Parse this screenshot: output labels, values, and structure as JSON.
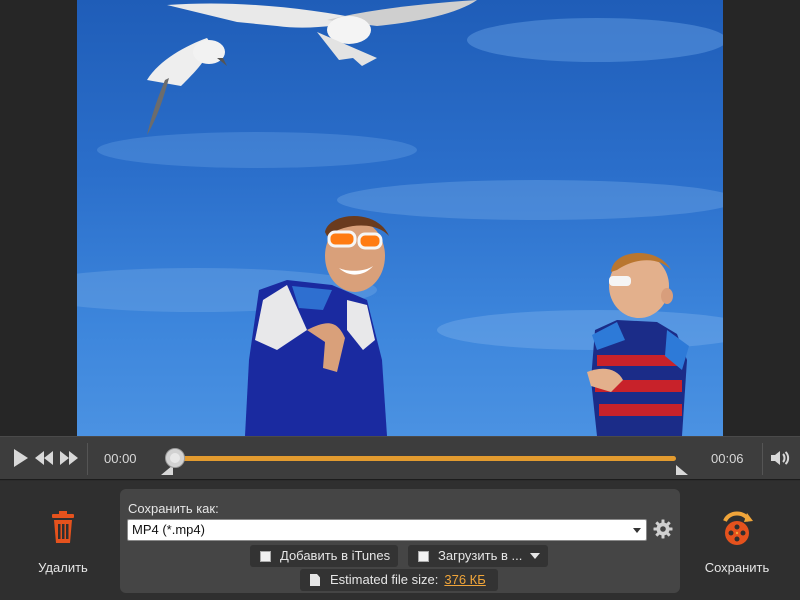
{
  "player": {
    "current_time": "00:00",
    "total_time": "00:06",
    "progress": 0.0
  },
  "actions": {
    "delete_label": "Удалить",
    "save_label": "Сохранить"
  },
  "save_panel": {
    "save_as_label": "Сохранить как:",
    "format_value": "MP4 (*.mp4)",
    "itunes_label": "Добавить в iTunes",
    "upload_label": "Загрузить в ...",
    "filesize_label": "Estimated file size:",
    "filesize_value": "376 КБ"
  },
  "colors": {
    "accent_orange": "#e39b2f",
    "delete_icon": "#e5521d",
    "background": "#2b2b2b",
    "panel": "#454545"
  },
  "icons": [
    "play-icon",
    "rewind-icon",
    "fast-forward-icon",
    "volume-icon",
    "trash-icon",
    "save-film-icon",
    "gear-icon",
    "file-icon"
  ]
}
